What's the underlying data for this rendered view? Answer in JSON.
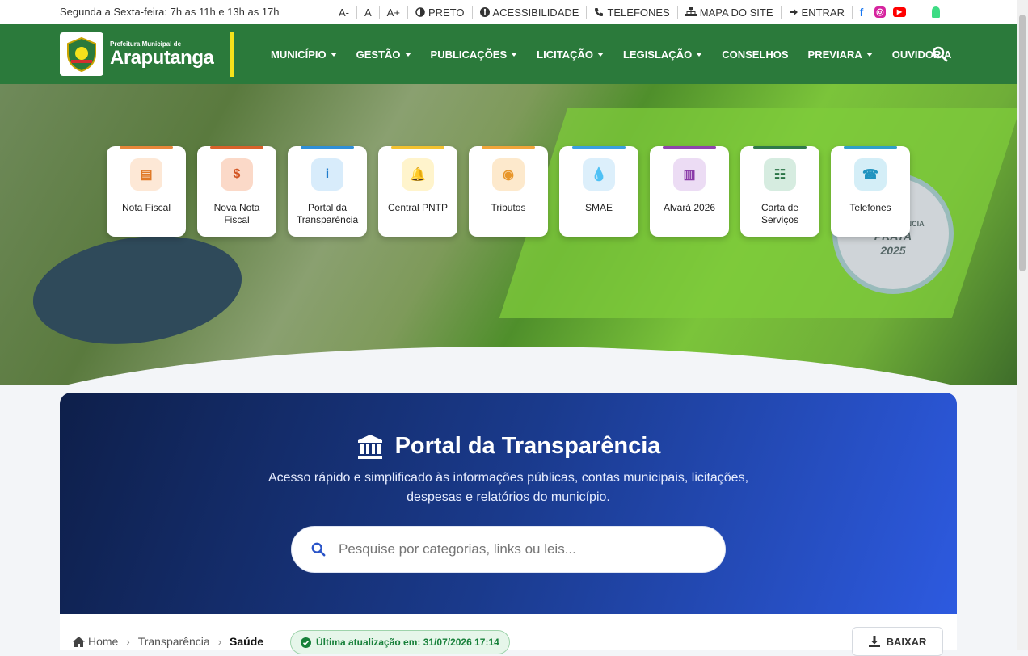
{
  "topbar": {
    "hours": "Segunda a Sexta-feira: 7h as 11h e 13h as 17h",
    "font_minus": "A-",
    "font_normal": "A",
    "font_plus": "A+",
    "contrast": "PRETO",
    "accessibility": "ACESSIBILIDADE",
    "phones": "TELEFONES",
    "sitemap": "MAPA DO SITE",
    "login": "ENTRAR",
    "social": [
      {
        "icon": "facebook-icon",
        "color": "#1877f2"
      },
      {
        "icon": "instagram-icon",
        "color": "#d6249f"
      },
      {
        "icon": "youtube-icon",
        "color": "#ff0000"
      },
      {
        "icon": "apple-icon",
        "color": "#111111"
      },
      {
        "icon": "android-icon",
        "color": "#3ddc84"
      }
    ]
  },
  "header": {
    "logo_small": "Prefeitura Municipal de",
    "logo_big": "Araputanga",
    "menu": [
      {
        "label": "MUNICÍPIO",
        "dropdown": true
      },
      {
        "label": "GESTÃO",
        "dropdown": true
      },
      {
        "label": "PUBLICAÇÕES",
        "dropdown": true
      },
      {
        "label": "LICITAÇÃO",
        "dropdown": true
      },
      {
        "label": "LEGISLAÇÃO",
        "dropdown": true
      },
      {
        "label": "CONSELHOS",
        "dropdown": false
      },
      {
        "label": "PREVIARA",
        "dropdown": true
      },
      {
        "label": "OUVIDORIA",
        "dropdown": false
      }
    ],
    "brand_color": "#2b7a3b"
  },
  "hero": {
    "medal_lines": [
      "TRANSPARÊNCIA",
      "PRATA",
      "2025"
    ]
  },
  "quick_links": [
    {
      "label": "Nota Fiscal",
      "icon": "document-icon",
      "accent": "#e8873a",
      "bg": "#fde8d6",
      "fg": "#e07a28"
    },
    {
      "label": "Nova Nota Fiscal",
      "icon": "invoice-dollar-icon",
      "accent": "#d9622b",
      "bg": "#fbd9c8",
      "fg": "#d25422"
    },
    {
      "label": "Portal da Transparência",
      "icon": "info-icon",
      "accent": "#2f8fd8",
      "bg": "#d8ecfb",
      "fg": "#1f7ccc"
    },
    {
      "label": "Central PNTP",
      "icon": "bell-icon",
      "accent": "#f2c230",
      "bg": "#fff4cc",
      "fg": "#e8b400"
    },
    {
      "label": "Tributos",
      "icon": "coins-icon",
      "accent": "#f0a53a",
      "bg": "#fde9cc",
      "fg": "#e8962a"
    },
    {
      "label": "SMAE",
      "icon": "water-drop-icon",
      "accent": "#3aa0e0",
      "bg": "#dceffb",
      "fg": "#2b8fd6"
    },
    {
      "label": "Alvará 2026",
      "icon": "building-icon",
      "accent": "#8e44ad",
      "bg": "#ecdcf4",
      "fg": "#8a3aa8"
    },
    {
      "label": "Carta de Serviços",
      "icon": "clipboard-icon",
      "accent": "#2f7a4a",
      "bg": "#d6ece0",
      "fg": "#2a7446"
    },
    {
      "label": "Telefones",
      "icon": "phone-book-icon",
      "accent": "#2fa0c8",
      "bg": "#d4eef7",
      "fg": "#1f93bf"
    }
  ],
  "portal": {
    "title": "Portal da Transparência",
    "description": "Acesso rápido e simplificado às informações públicas, contas municipais, licitações, despesas e relatórios do município.",
    "search_placeholder": "Pesquise por categorias, links ou leis..."
  },
  "breadcrumb": {
    "home": "Home",
    "level1": "Transparência",
    "current": "Saúde",
    "updated": "Última atualização em: 31/07/2026 17:14",
    "download": "BAIXAR"
  }
}
